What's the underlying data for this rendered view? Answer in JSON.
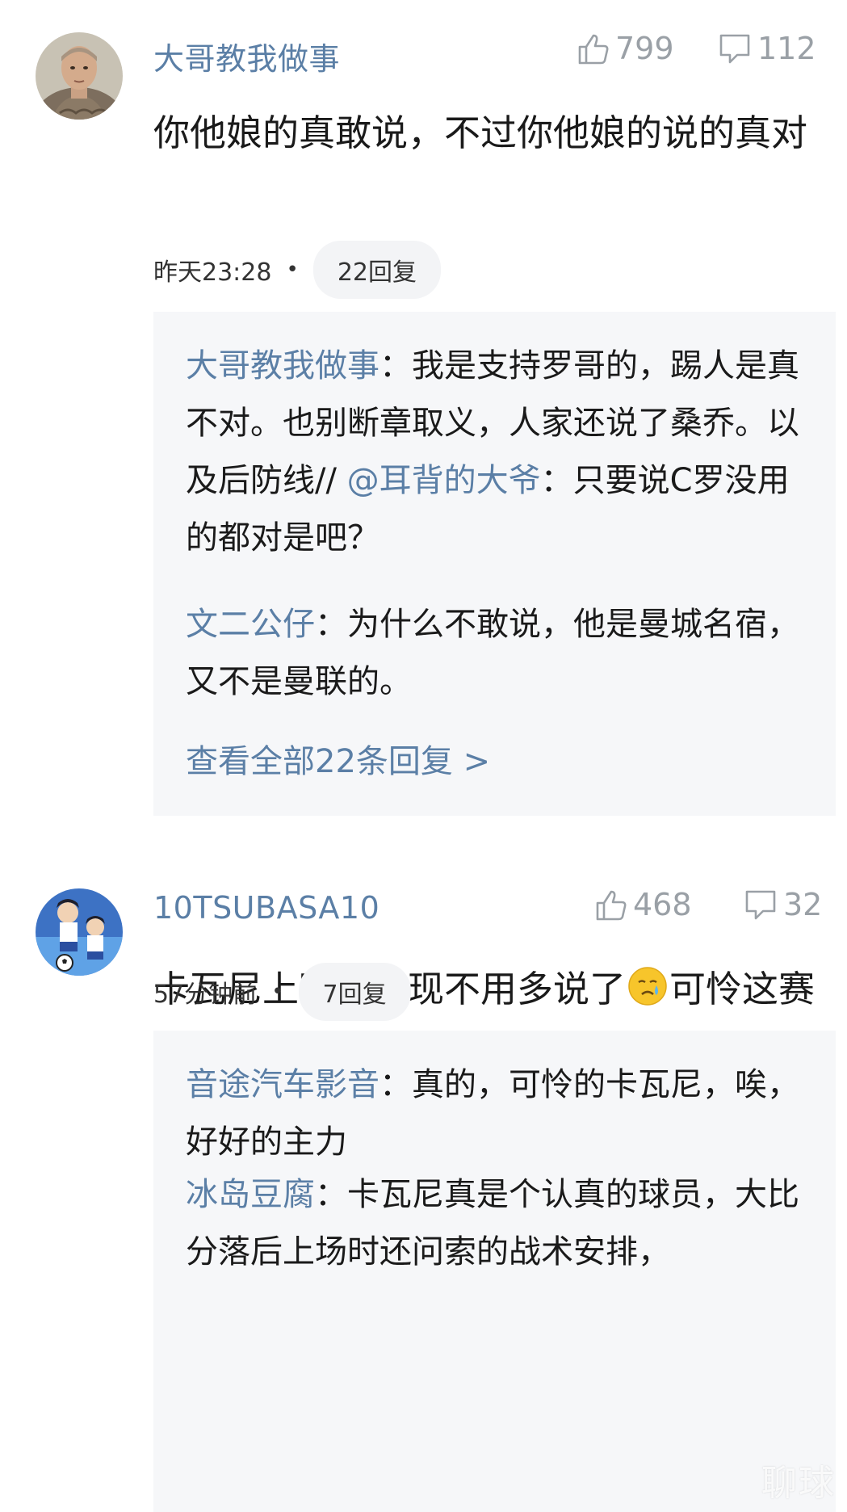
{
  "comments": [
    {
      "username": "大哥教我做事",
      "likes": "799",
      "replies_count": "112",
      "text": "你他娘的真敢说，不过你他娘的说的真对",
      "time": "昨天23:28",
      "reply_label": "22回复",
      "replies": [
        {
          "name": "大哥教我做事",
          "text_a": "：我是支持罗哥的，踢人是真不对。也别断章取义，人家还说了桑乔。以及后防线// ",
          "mention": "@耳背的大爷",
          "text_b": "：只要说C罗没用的都对是吧？"
        },
        {
          "name": "文二公仔",
          "text": "：为什么不敢说，他是曼城名宿，又不是曼联的。"
        }
      ],
      "view_all": "查看全部22条回复 >"
    },
    {
      "username": "10TSUBASA10",
      "likes": "468",
      "replies_count": "32",
      "text_a": "卡瓦尼上赛季表现不用多说了",
      "emoji": "crying-face-icon",
      "text_b": "可怜这赛季先主动让出了号码又被动让出了出场时间。。。",
      "time": "57分钟前",
      "reply_label": "7回复",
      "replies": [
        {
          "name": "音途汽车影音",
          "text": "：真的，可怜的卡瓦尼，唉，好好的主力"
        },
        {
          "name": "冰岛豆腐",
          "text": "：卡瓦尼真是个认真的球员，大比分落后上场时还问索的战术安排，"
        }
      ]
    }
  ],
  "watermark": "聊球",
  "colors": {
    "username": "#5b7fa6",
    "icon_gray": "#9aa0a6",
    "reply_bg": "#f6f7f9",
    "pill_bg": "#f3f4f6"
  }
}
